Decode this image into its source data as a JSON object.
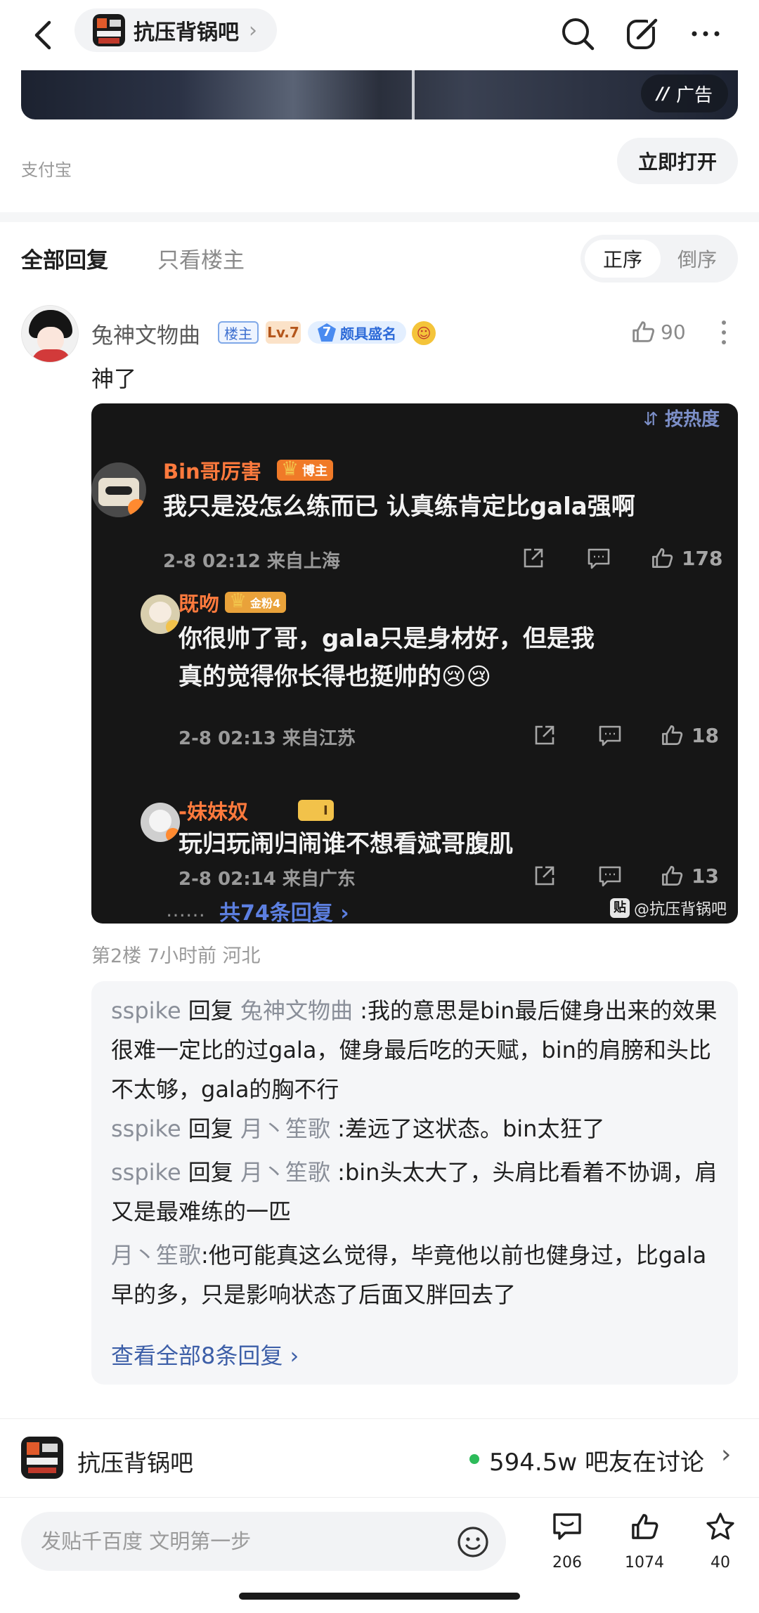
{
  "header": {
    "forum_name": "抗压背锅吧",
    "chevron": "›"
  },
  "ad": {
    "tag": "广告",
    "tag_mark": "//",
    "source": "支付宝",
    "open_label": "立即打开"
  },
  "filters": {
    "all_label": "全部回复",
    "op_only_label": "只看楼主",
    "sort_asc": "正序",
    "sort_desc": "倒序"
  },
  "post": {
    "username": "兔神文物曲",
    "badge_op": "楼主",
    "badge_level": "Lv.7",
    "badge_title_level": "7",
    "badge_title": "颇具盛名",
    "like_count": "90",
    "text": "神了",
    "floor_meta": "第2楼 7小时前 河北"
  },
  "embedded": {
    "sort_label": "按热度",
    "comments": [
      {
        "name": "Bin哥厉害",
        "badge": "博主",
        "body_lines": [
          "我只是没怎么练而已 认真练肯定比gala强啊"
        ],
        "meta": "2-8 02:12 来自上海",
        "likes": "178"
      },
      {
        "name": "既吻",
        "badge": "金粉4",
        "body_lines": [
          "你很帅了哥，gala只是身材好，但是我",
          "真的觉得你长得也挺帅的😢😢"
        ],
        "meta": "2-8 02:13 来自江苏",
        "likes": "18"
      },
      {
        "name": "-妹妹奴",
        "badge": "I",
        "body_lines": [
          "玩归玩闹归闹谁不想看斌哥腹肌"
        ],
        "meta": "2-8 02:14 来自广东",
        "likes": "13"
      }
    ],
    "more_dots": "……",
    "total_replies": "共74条回复 ›",
    "watermark_icon": "贴",
    "watermark": "@抗压背锅吧"
  },
  "sub_replies": {
    "items": [
      {
        "who": "sspike",
        "rep": " 回复 ",
        "to": "兔神文物曲",
        "text": " :我的意思是bin最后健身出来的效果很难一定比的过gala，健身最后吃的天赋，bin的肩膀和头比不太够，gala的胸不行"
      },
      {
        "who": "sspike",
        "rep": " 回复 ",
        "to": "月丶笙歌",
        "text": " :差远了这状态。bin太狂了"
      },
      {
        "who": "sspike",
        "rep": " 回复 ",
        "to": "月丶笙歌",
        "text": " :bin头太大了，头肩比看着不协调，肩又是最难练的一匹"
      },
      {
        "who": "月丶笙歌",
        "rep": "",
        "to": "",
        "text": ":他可能真这么觉得，毕竟他以前也健身过，比gala早的多，只是影响状态了后面又胖回去了"
      }
    ],
    "see_all": "查看全部8条回复 ›"
  },
  "bottom_forum": {
    "name": "抗压背锅吧",
    "count_text": "594.5w 吧友在讨论",
    "chevron": "›"
  },
  "bottom_bar": {
    "placeholder": "发贴千百度 文明第一步",
    "comments": "206",
    "likes": "1074",
    "favorites": "40"
  },
  "colors": {
    "accent_blue": "#3d5fa8",
    "hot_orange": "#ff7a3d",
    "online_green": "#2dbb5a"
  }
}
